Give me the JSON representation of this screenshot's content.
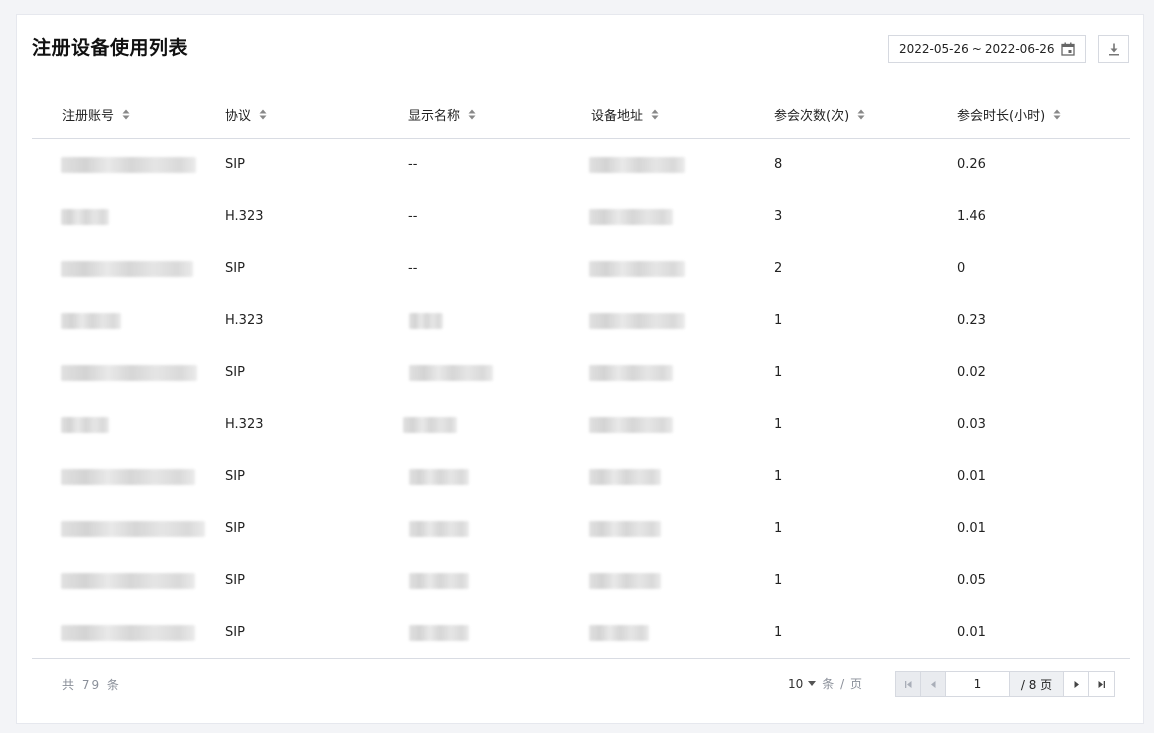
{
  "header": {
    "title": "注册设备使用列表",
    "date_start": "2022-05-26",
    "date_sep": "~",
    "date_end": "2022-06-26",
    "calendar_icon": "calendar-icon",
    "download_icon": "download-icon"
  },
  "table": {
    "columns": [
      "注册账号",
      "协议",
      "显示名称",
      "设备地址",
      "参会次数(次)",
      "参会时长(小时)"
    ],
    "rows": [
      {
        "protocol": "SIP",
        "display_name": "--",
        "count": "8",
        "duration": "0.26"
      },
      {
        "protocol": "H.323",
        "display_name": "--",
        "count": "3",
        "duration": "1.46"
      },
      {
        "protocol": "SIP",
        "display_name": "--",
        "count": "2",
        "duration": "0"
      },
      {
        "protocol": "H.323",
        "display_name": "",
        "count": "1",
        "duration": "0.23"
      },
      {
        "protocol": "SIP",
        "display_name": "",
        "count": "1",
        "duration": "0.02"
      },
      {
        "protocol": "H.323",
        "display_name": "",
        "count": "1",
        "duration": "0.03"
      },
      {
        "protocol": "SIP",
        "display_name": "",
        "count": "1",
        "duration": "0.01"
      },
      {
        "protocol": "SIP",
        "display_name": "",
        "count": "1",
        "duration": "0.01"
      },
      {
        "protocol": "SIP",
        "display_name": "",
        "count": "1",
        "duration": "0.05"
      },
      {
        "protocol": "SIP",
        "display_name": "",
        "count": "1",
        "duration": "0.01"
      }
    ]
  },
  "footer": {
    "total_text": "共 79 条",
    "page_size": "10",
    "page_size_unit": "条 / 页",
    "current_page": "1",
    "total_pages": "/ 8 页"
  },
  "colors": {
    "border": "#d6d9e0",
    "muted_text": "#8a8f99",
    "disabled_bg": "#e9ebef"
  }
}
